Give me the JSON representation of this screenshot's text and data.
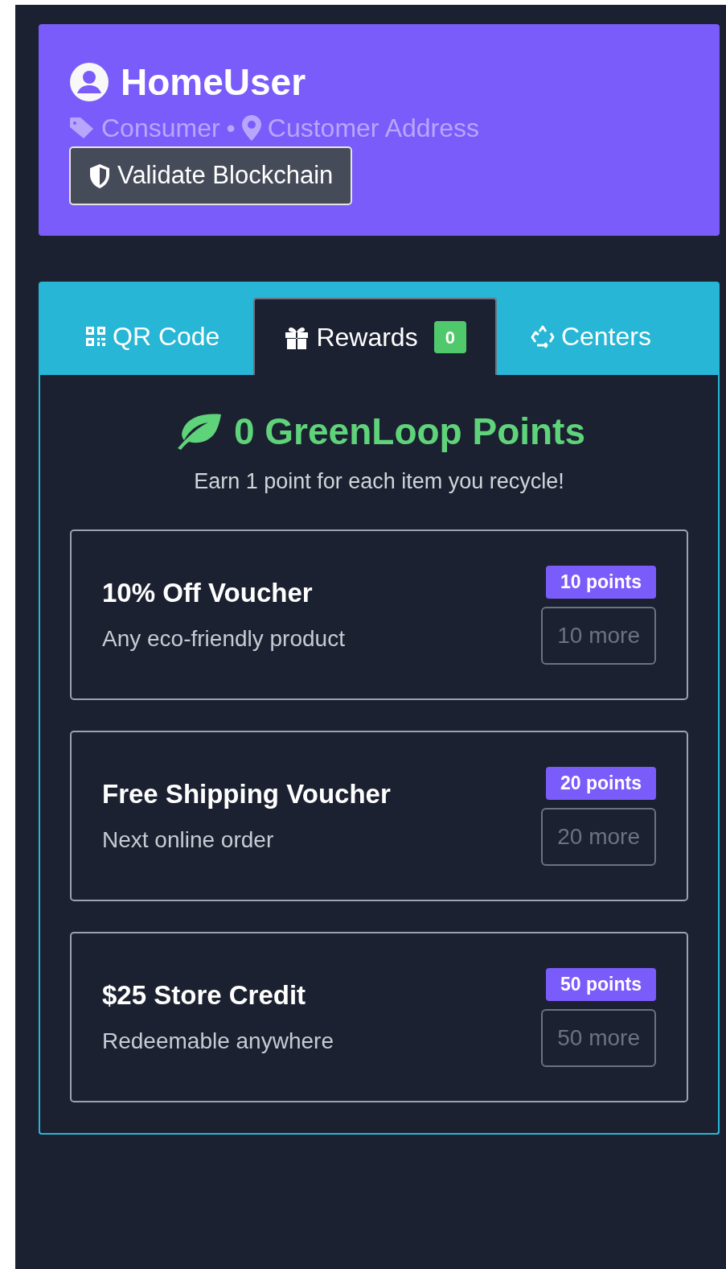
{
  "profile": {
    "name": "HomeUser",
    "role": "Consumer",
    "separator": "•",
    "address": "Customer Address",
    "validate_button": "Validate Blockchain"
  },
  "tabs": [
    {
      "kind": "qr",
      "label": "QR Code",
      "selected": false
    },
    {
      "kind": "gift",
      "label": "Rewards",
      "badge": "0",
      "selected": true
    },
    {
      "kind": "recycle",
      "label": "Centers",
      "selected": false
    }
  ],
  "rewards": {
    "title": "0 GreenLoop Points",
    "subtitle": "Earn 1 point for each item you recycle!",
    "items": [
      {
        "title": "10% Off Voucher",
        "description": "Any eco-friendly product",
        "cost": "10 points",
        "action": "10 more",
        "disabled": true
      },
      {
        "title": "Free Shipping Voucher",
        "description": "Next online order",
        "cost": "20 points",
        "action": "20 more",
        "disabled": true
      },
      {
        "title": "$25 Store Credit",
        "description": "Redeemable anywhere",
        "cost": "50 points",
        "action": "50 more",
        "disabled": true
      }
    ]
  }
}
